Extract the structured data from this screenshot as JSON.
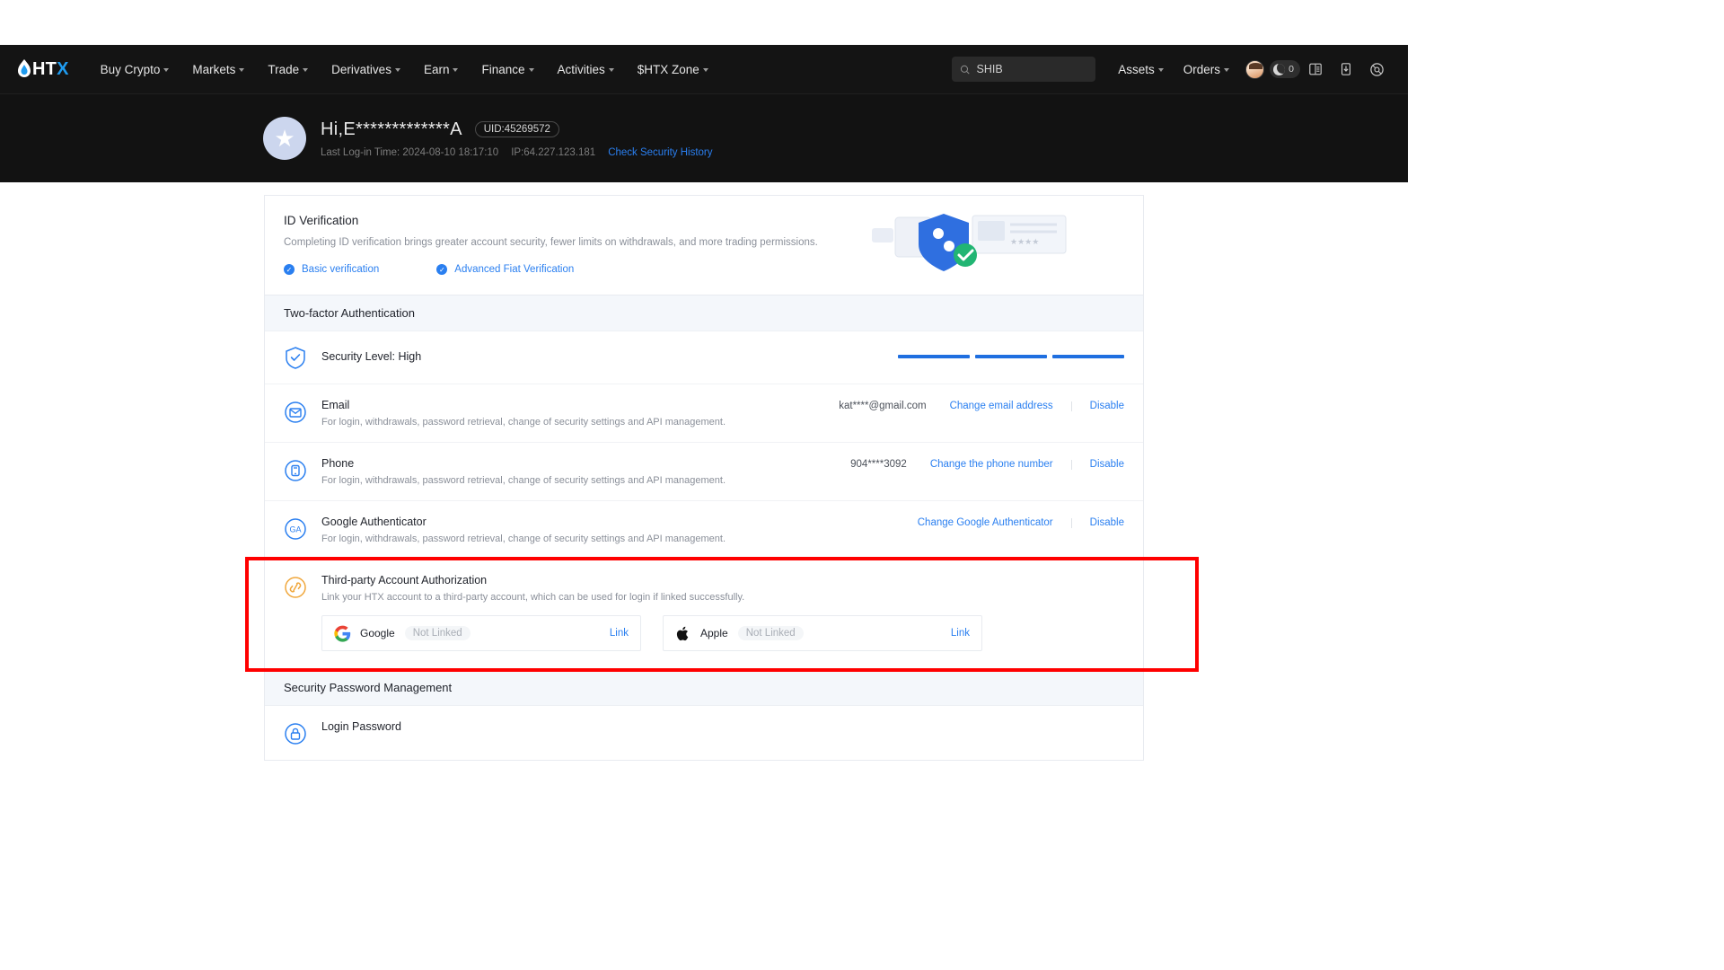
{
  "nav": {
    "logo_text": "HTX",
    "items": [
      {
        "label": "Buy Crypto",
        "caret": true
      },
      {
        "label": "Markets",
        "caret": true
      },
      {
        "label": "Trade",
        "caret": true
      },
      {
        "label": "Derivatives",
        "caret": true
      },
      {
        "label": "Earn",
        "caret": true
      },
      {
        "label": "Finance",
        "caret": true
      },
      {
        "label": "Activities",
        "caret": true
      },
      {
        "label": "$HTX Zone",
        "caret": true
      }
    ],
    "search": {
      "value": "SHIB",
      "placeholder": "SHIB"
    },
    "assets_label": "Assets",
    "orders_label": "Orders",
    "points_count": "0"
  },
  "account": {
    "greeting": "Hi,E*************A",
    "uid": "UID:45269572",
    "last_login_label": "Last Log-in Time: 2024-08-10 18:17:10",
    "ip_label": "IP:64.227.123.181",
    "security_history_link": "Check Security History"
  },
  "id_verification": {
    "title": "ID Verification",
    "description": "Completing ID verification brings greater account security, fewer limits on withdrawals, and more trading permissions.",
    "links": [
      {
        "label": "Basic verification"
      },
      {
        "label": "Advanced Fiat Verification"
      }
    ]
  },
  "two_factor": {
    "header": "Two-factor Authentication",
    "security_level_label": "Security Level: High",
    "security_bars": 3,
    "rows": [
      {
        "icon": "email-icon",
        "title": "Email",
        "subtitle": "For login, withdrawals, password retrieval, change of security settings and API management.",
        "value": "kat****@gmail.com",
        "primary_link": "Change email address",
        "secondary_link": "Disable"
      },
      {
        "icon": "phone-icon",
        "title": "Phone",
        "subtitle": "For login, withdrawals, password retrieval, change of security settings and API management.",
        "value": "904****3092",
        "primary_link": "Change the phone number",
        "secondary_link": "Disable"
      },
      {
        "icon": "google-authenticator-icon",
        "title": "Google Authenticator",
        "subtitle": "For login, withdrawals, password retrieval, change of security settings and API management.",
        "value": "",
        "primary_link": "Change Google Authenticator",
        "secondary_link": "Disable"
      }
    ]
  },
  "third_party": {
    "title": "Third-party Account Authorization",
    "subtitle": "Link your HTX account to a third-party account, which can be used for login if linked successfully.",
    "accounts": [
      {
        "brand": "Google",
        "status": "Not Linked",
        "link": "Link",
        "icon": "google-logo-icon"
      },
      {
        "brand": "Apple",
        "status": "Not Linked",
        "link": "Link",
        "icon": "apple-logo-icon"
      }
    ]
  },
  "password_section": {
    "header": "Security Password Management",
    "rows": [
      {
        "title": "Login Password",
        "icon": "lock-icon"
      }
    ]
  },
  "colors": {
    "accent_blue": "#2a7ff0",
    "nav_bg": "#141414",
    "highlight_red": "#ff0000",
    "section_bg": "#f4f7fb"
  }
}
